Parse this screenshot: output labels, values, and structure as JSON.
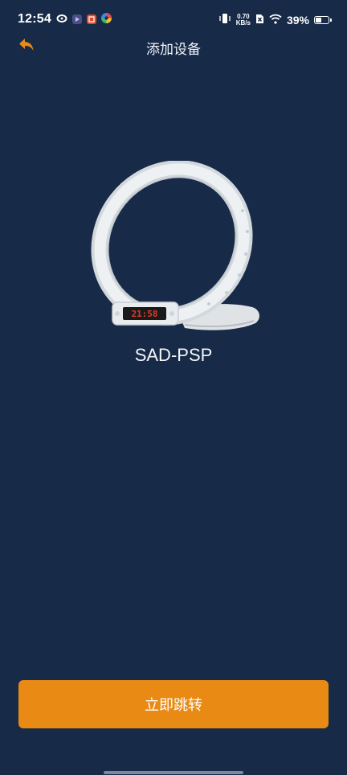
{
  "status_bar": {
    "time": "12:54",
    "net_speed_value": "0.70",
    "net_speed_unit": "KB/s",
    "battery_percent": "39%",
    "battery_level": 0.39,
    "icons": [
      "weibo-icon",
      "video-player-icon",
      "app-store-icon",
      "color-wheel-icon",
      "vibrate-icon",
      "sim-disabled-icon",
      "wifi-icon",
      "battery-icon"
    ]
  },
  "header": {
    "title": "添加设备",
    "back_icon": "back-arrow-icon"
  },
  "product": {
    "device_name": "SAD-PSP",
    "clock_display": "21:58"
  },
  "actions": {
    "jump_label": "立即跳转"
  },
  "colors": {
    "background": "#172a48",
    "accent": "#e98a14"
  }
}
